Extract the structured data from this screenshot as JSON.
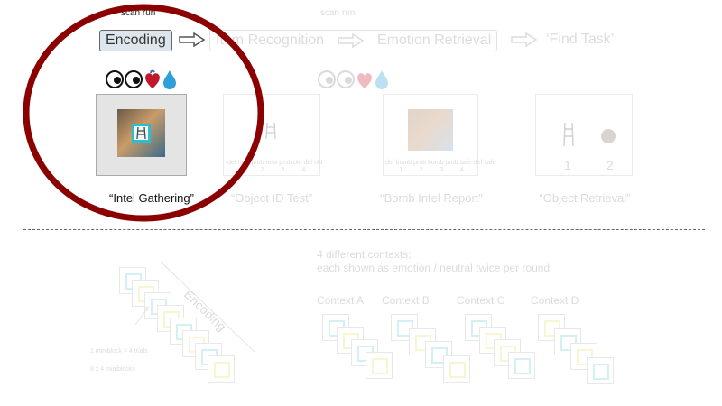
{
  "scan_run_label_active": "scan run",
  "scan_run_label_faded": "scan run",
  "stages": [
    {
      "label": "Encoding"
    },
    {
      "label": "Item Recognition"
    },
    {
      "label": "Emotion Retrieval"
    },
    {
      "label": "‘Find Task’"
    }
  ],
  "panels": [
    {
      "caption": "“Intel Gathering”"
    },
    {
      "caption": "“Object ID Test”",
      "scale_text": "def new  prob new  prob old  def old",
      "scale_numbers": [
        "1",
        "2",
        "3",
        "4"
      ]
    },
    {
      "caption": "“Bomb Intel Report”",
      "scale_text": "def bomb  prob bomb  prob safe  def safe",
      "scale_numbers": [
        "1",
        "2",
        "3",
        "4"
      ]
    },
    {
      "caption": "“Object Retrieval”",
      "choices": [
        "1",
        "2"
      ]
    }
  ],
  "bottom": {
    "encoding_label": "Encoding",
    "miniblock_note": "1 miniblock = 4 trials",
    "miniblocks_count": "8 x 4 miniblocks",
    "contexts_title": "4 different contexts:",
    "contexts_subtitle": "each shown as emotion / neutral twice per round",
    "contexts": [
      "Context A",
      "Context B",
      "Context C",
      "Context D"
    ]
  },
  "colors": {
    "highlight_circle": "#8b0000",
    "encoding_box_fill": "#dde6ec",
    "frame_cyan": "#55c8d8",
    "frame_yellow": "#f2ec9a",
    "faded_text": "#dcdcdc"
  },
  "icons": [
    "eye-icon",
    "eye-icon",
    "heart-icon",
    "drop-icon",
    "arrow-right-icon"
  ]
}
